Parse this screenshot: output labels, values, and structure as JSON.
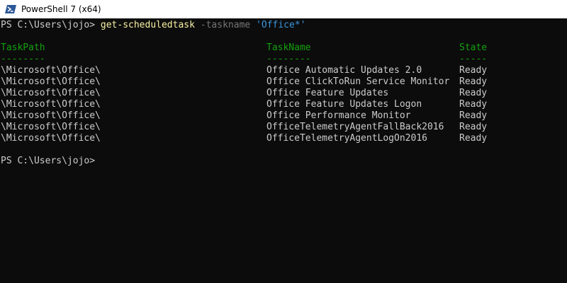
{
  "window": {
    "title": "PowerShell 7 (x64)",
    "icon": "powershell-icon"
  },
  "console": {
    "prompt1": {
      "prompt": "PS C:\\Users\\jojo> ",
      "command": "get-scheduledtask",
      "parameter": " -taskname ",
      "argument": "'Office*'"
    },
    "headers": {
      "task_path": "TaskPath",
      "task_name": "TaskName",
      "state": "State"
    },
    "separators": {
      "task_path": "--------",
      "task_name": "--------",
      "state": "-----"
    },
    "rows": [
      {
        "task_path": "\\Microsoft\\Office\\",
        "task_name": "Office Automatic Updates 2.0",
        "state": "Ready"
      },
      {
        "task_path": "\\Microsoft\\Office\\",
        "task_name": "Office ClickToRun Service Monitor",
        "state": "Ready"
      },
      {
        "task_path": "\\Microsoft\\Office\\",
        "task_name": "Office Feature Updates",
        "state": "Ready"
      },
      {
        "task_path": "\\Microsoft\\Office\\",
        "task_name": "Office Feature Updates Logon",
        "state": "Ready"
      },
      {
        "task_path": "\\Microsoft\\Office\\",
        "task_name": "Office Performance Monitor",
        "state": "Ready"
      },
      {
        "task_path": "\\Microsoft\\Office\\",
        "task_name": "OfficeTelemetryAgentFallBack2016",
        "state": "Ready"
      },
      {
        "task_path": "\\Microsoft\\Office\\",
        "task_name": "OfficeTelemetryAgentLogOn2016",
        "state": "Ready"
      }
    ],
    "prompt2": "PS C:\\Users\\jojo>"
  },
  "colors": {
    "background": "#0c0c0c",
    "foreground": "#cccccc",
    "header_green": "#13a10e",
    "command_yellow": "#f9f1a5",
    "parameter_gray": "#767676",
    "string_blue": "#3a96dd"
  }
}
